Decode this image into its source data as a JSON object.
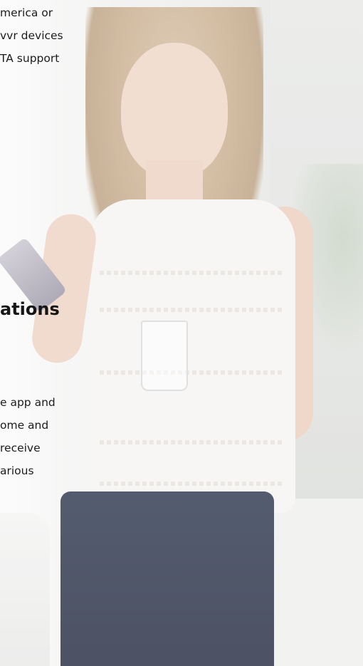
{
  "top_paragraph": {
    "lines": [
      "merica or",
      "vvr devices",
      "TA support"
    ]
  },
  "section_heading": "ations",
  "bottom_paragraph": {
    "lines": [
      "e app and",
      "ome and",
      "receive",
      "arious"
    ]
  },
  "photo": {
    "icon": "woman-with-phone-photo",
    "accent_colors": {
      "jeans": "#262d42",
      "top": "#f7f5f3",
      "hair": "#c9ae8f"
    }
  }
}
